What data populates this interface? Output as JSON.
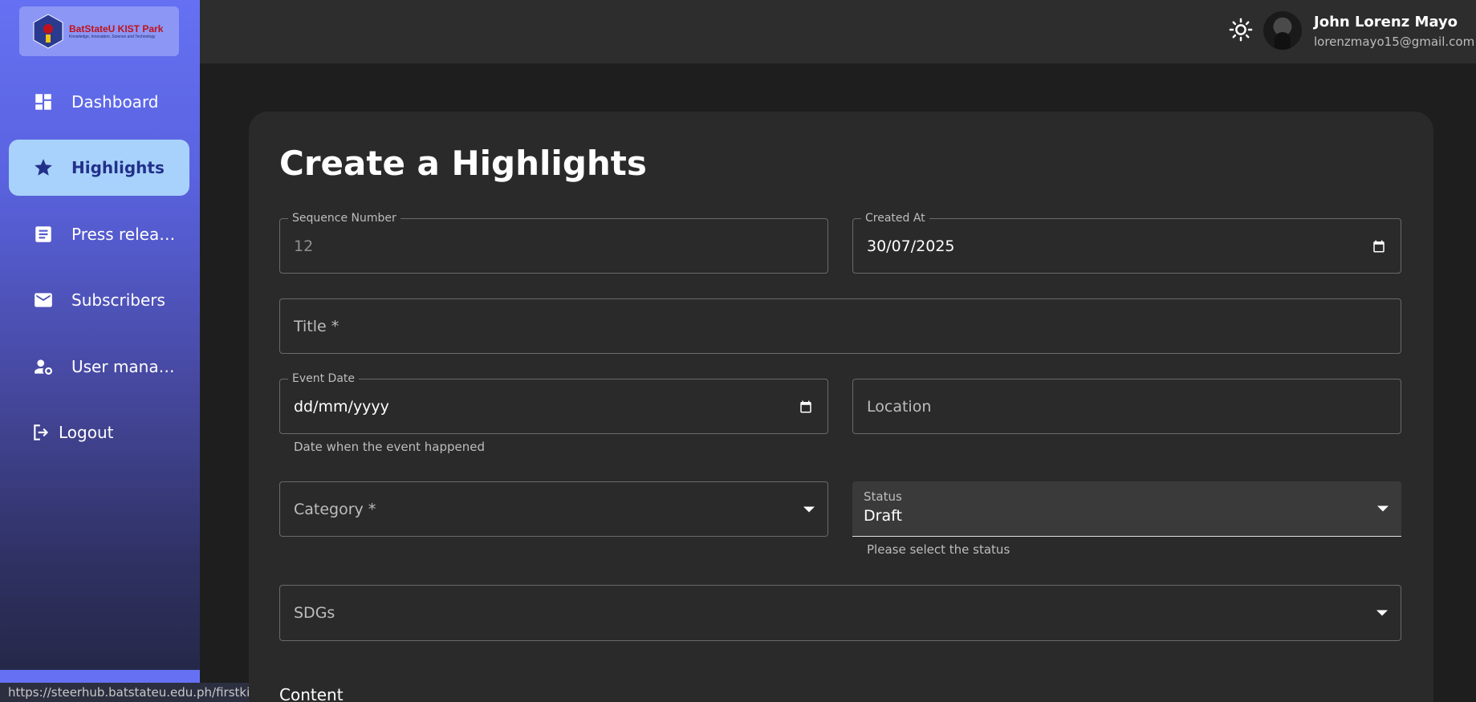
{
  "brand": {
    "logo_title": "BatStateU KIST Park",
    "logo_tagline": "Knowledge, Innovation, Science and Technology"
  },
  "sidebar": {
    "items": [
      {
        "label": "Dashboard",
        "icon": "dashboard-icon"
      },
      {
        "label": "Highlights",
        "icon": "star-icon",
        "active": true
      },
      {
        "label": "Press releas...",
        "icon": "article-icon"
      },
      {
        "label": "Subscribers",
        "icon": "mail-icon"
      },
      {
        "label": "User manag...",
        "icon": "user-settings-icon"
      },
      {
        "label": "Logout",
        "icon": "logout-icon"
      }
    ]
  },
  "status_url": "https://steerhub.batstateu.edu.ph/firstkistpark/",
  "header": {
    "user_name": "John Lorenz Mayo",
    "user_email": "lorenzmayo15@gmail.com",
    "theme_icon": "sun-icon"
  },
  "form": {
    "title": "Create a Highlights",
    "sequence": {
      "label": "Sequence Number",
      "value": "12"
    },
    "created_at": {
      "label": "Created At",
      "value": "30/07/2025"
    },
    "title_field": {
      "placeholder": "Title *"
    },
    "event_date": {
      "label": "Event Date",
      "value": "dd/mm/yyyy",
      "helper": "Date when the event happened"
    },
    "location": {
      "placeholder": "Location"
    },
    "category": {
      "placeholder": "Category *"
    },
    "status": {
      "label": "Status",
      "value": "Draft",
      "helper": "Please select the status"
    },
    "sdgs": {
      "placeholder": "SDGs"
    },
    "content_label": "Content"
  },
  "colors": {
    "sidebar_top": "#6571f2",
    "active_bg": "#a8d2fb",
    "active_text": "#23308a",
    "card_bg": "#2a2a2a"
  }
}
